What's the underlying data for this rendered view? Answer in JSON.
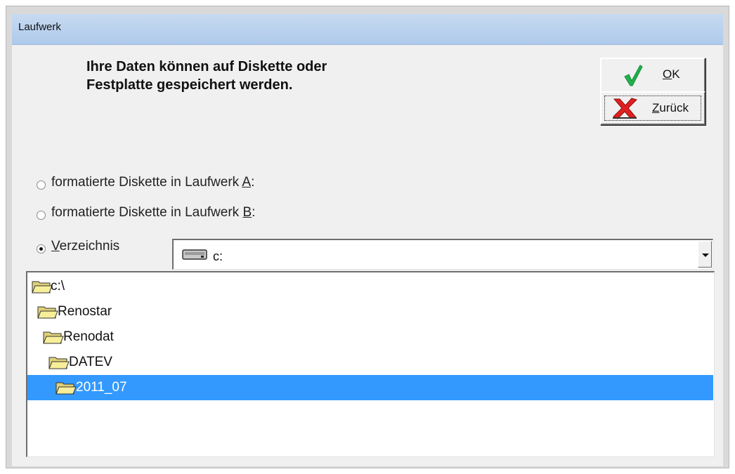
{
  "window": {
    "title": "Laufwerk"
  },
  "message": "Ihre Daten können  auf Diskette oder\nFestplatte gespeichert werden.",
  "buttons": {
    "ok": {
      "label": "OK",
      "mnemonic": "O",
      "rest": "K",
      "icon": "checkmark-icon"
    },
    "back": {
      "label": "Zurück",
      "mnemonic": "Z",
      "rest": "urück",
      "icon": "red-x-icon"
    }
  },
  "options": [
    {
      "pre": "formatierte Diskette in Laufwerk ",
      "mnemonic": "A",
      "post": ":",
      "checked": false
    },
    {
      "pre": "formatierte Diskette in Laufwerk ",
      "mnemonic": "B",
      "post": ":",
      "checked": false
    },
    {
      "pre": "",
      "mnemonic": "V",
      "post": "erzeichnis",
      "checked": true
    }
  ],
  "drive_combo": {
    "value": "c:",
    "icon": "hard-drive-icon"
  },
  "tree": [
    {
      "label": "c:\\",
      "icon": "open-folder-icon",
      "selected": false
    },
    {
      "label": "Renostar",
      "icon": "open-folder-icon",
      "selected": false
    },
    {
      "label": "Renodat",
      "icon": "open-folder-icon",
      "selected": false
    },
    {
      "label": "DATEV",
      "icon": "open-folder-icon",
      "selected": false
    },
    {
      "label": "2011_07",
      "icon": "open-folder-icon",
      "selected": true
    }
  ],
  "colors": {
    "selection": "#3399ff",
    "titlebar": "#b7d0ef",
    "check": "#22b14c",
    "cross": "#e02020"
  }
}
